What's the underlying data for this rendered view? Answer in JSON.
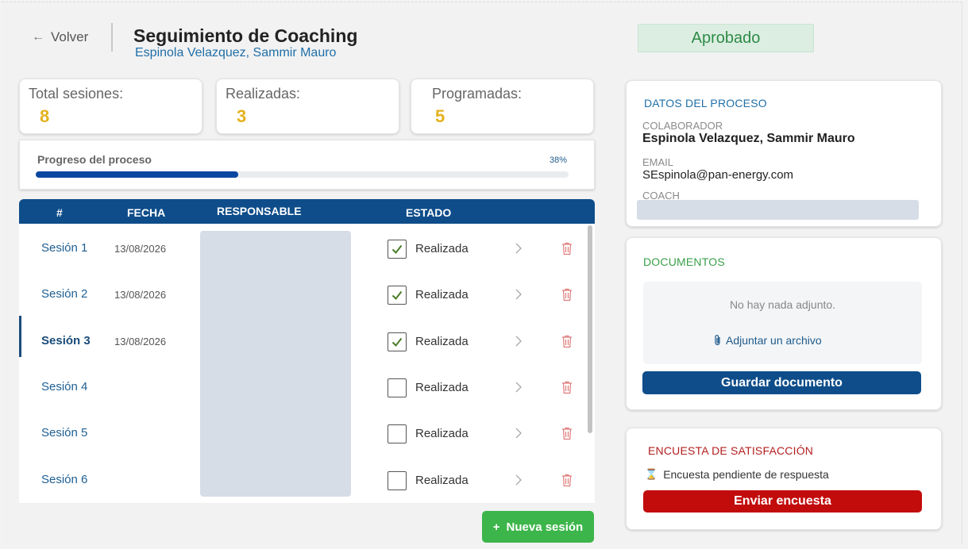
{
  "header": {
    "back_label": "Volver",
    "title": "Seguimiento de Coaching",
    "subtitle": "Espinola Velazquez, Sammir Mauro",
    "status": "Aprobado"
  },
  "stats": {
    "total_label": "Total sesiones:",
    "total_value": "8",
    "done_label": "Realizadas:",
    "done_value": "3",
    "scheduled_label": "Programadas:",
    "scheduled_value": "5"
  },
  "progress": {
    "label": "Progreso del proceso",
    "percent_text": "38%",
    "fraction": 0.38
  },
  "table": {
    "headers": [
      "#",
      "FECHA",
      "RESPONSABLE",
      "ESTADO"
    ],
    "rows": [
      {
        "session": "Sesión 1",
        "date": "13/08/2026",
        "checked": true,
        "status": "Realizada"
      },
      {
        "session": "Sesión 2",
        "date": "13/08/2026",
        "checked": true,
        "status": "Realizada"
      },
      {
        "session": "Sesión 3",
        "date": "13/08/2026",
        "checked": true,
        "status": "Realizada"
      },
      {
        "session": "Sesión 4",
        "date": "",
        "checked": false,
        "status": "Realizada"
      },
      {
        "session": "Sesión 5",
        "date": "",
        "checked": false,
        "status": "Realizada"
      },
      {
        "session": "Sesión 6",
        "date": "",
        "checked": false,
        "status": "Realizada"
      }
    ],
    "active_row": 2
  },
  "new_session_label": "Nueva sesión",
  "datos": {
    "title": "DATOS DEL PROCESO",
    "collab_label": "COLABORADOR",
    "collab_value": "Espinola Velazquez, Sammir Mauro",
    "email_label": "EMAIL",
    "email_value": "SEspinola@pan-energy.com",
    "coach_label": "COACH"
  },
  "documentos": {
    "title": "DOCUMENTOS",
    "empty_text": "No hay nada adjunto.",
    "attach_label": "Adjuntar un archivo",
    "save_label": "Guardar documento"
  },
  "encuesta": {
    "title": "ENCUESTA DE SATISFACCIÓN",
    "pending_text": "Encuesta pendiente de respuesta",
    "send_label": "Enviar encuesta"
  },
  "colors": {
    "primary": "#0e4d8a",
    "success": "#3cb54a",
    "danger": "#c20c0c",
    "stat_value": "#e4b21d",
    "approved_bg": "#dceee2"
  },
  "icons": [
    "arrow-left-icon",
    "check-icon",
    "chevron-right-icon",
    "trash-icon",
    "paperclip-icon",
    "plus-icon",
    "hourglass-icon"
  ]
}
